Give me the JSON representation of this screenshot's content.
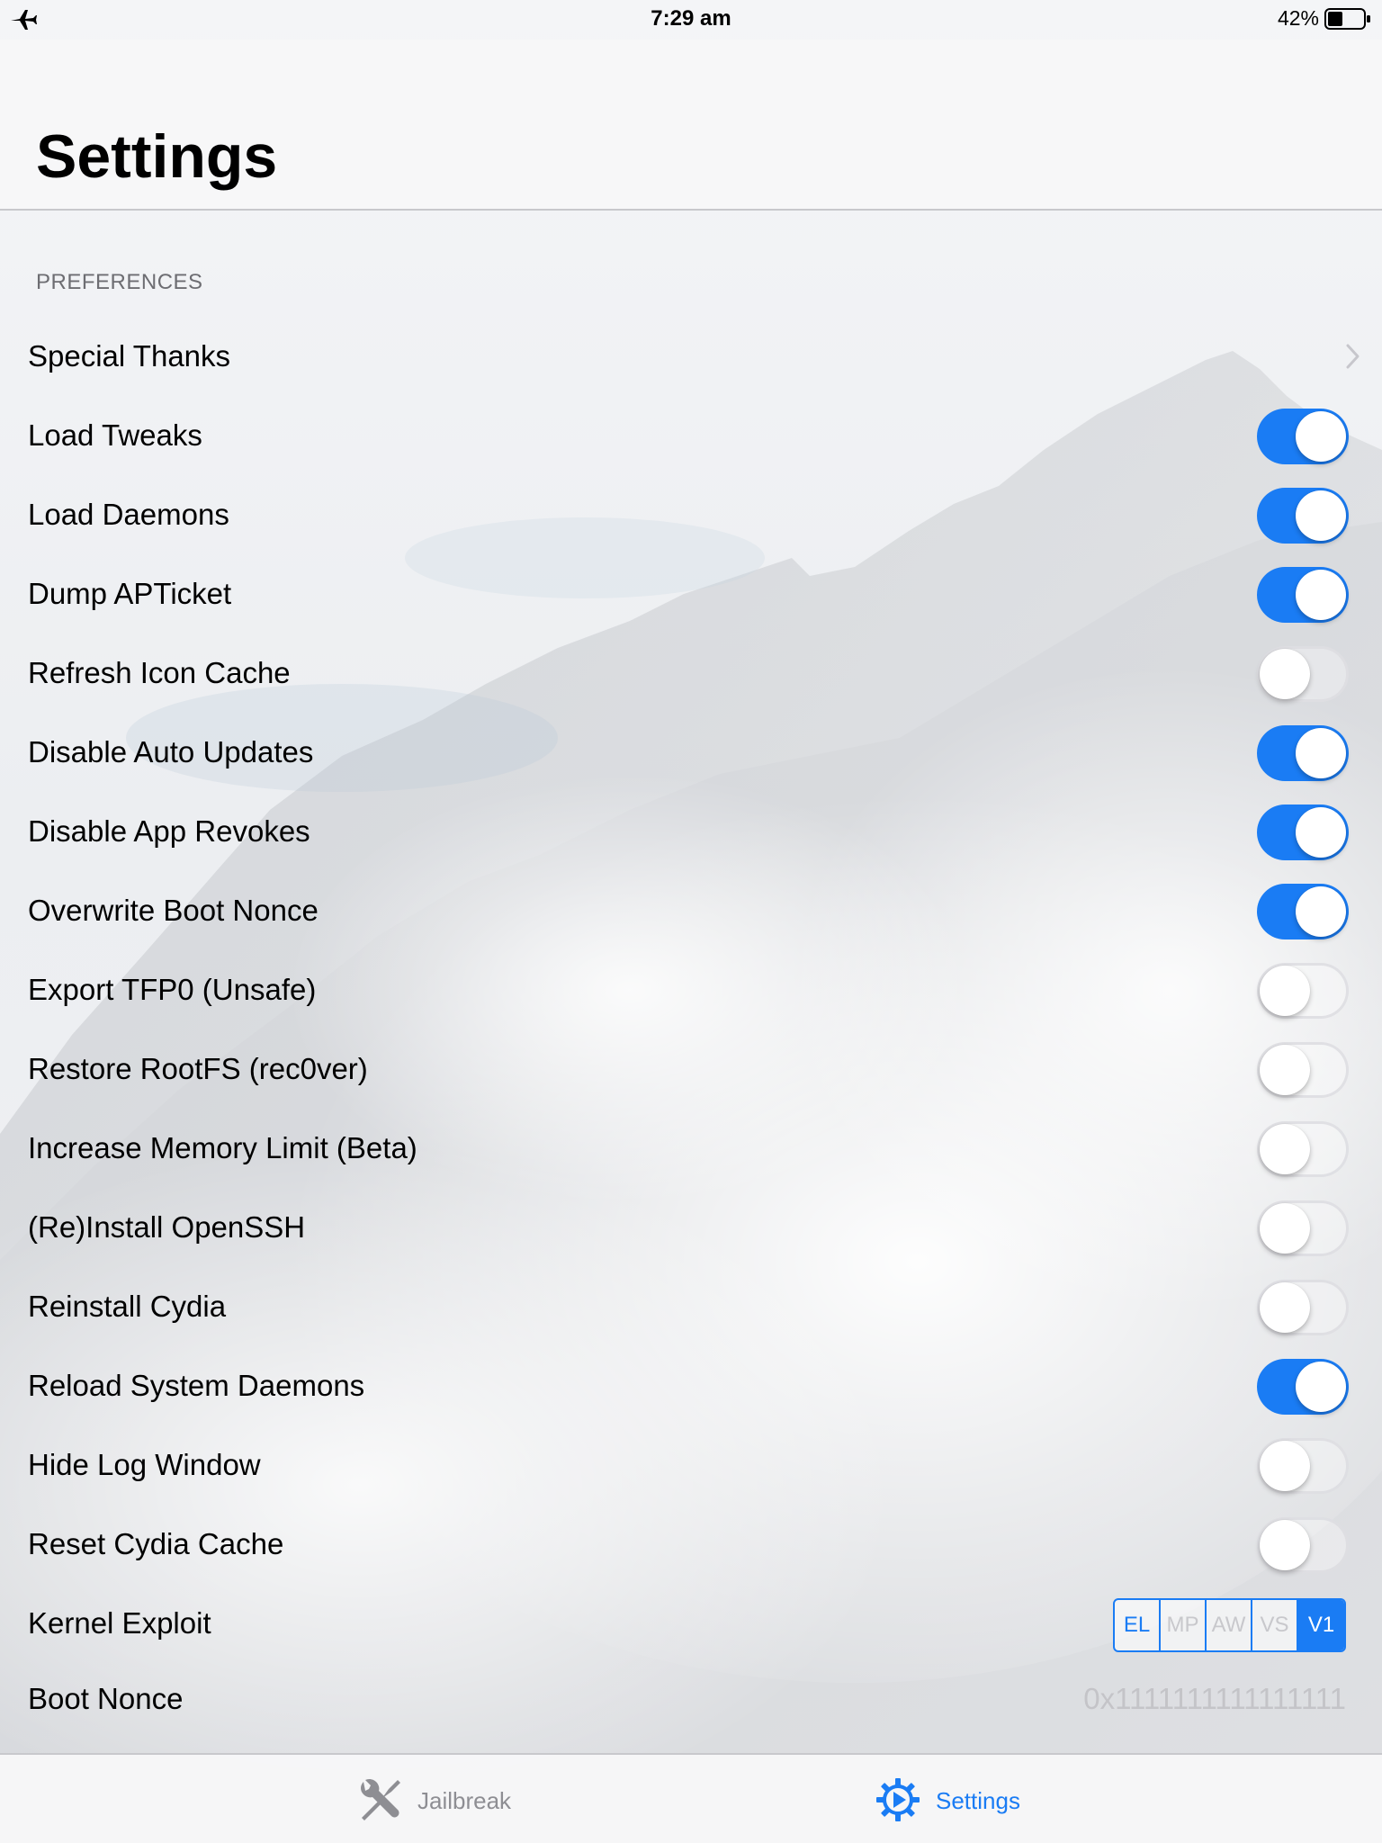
{
  "status_bar": {
    "time": "7:29 am",
    "battery_percent": "42%",
    "battery_level": 0.42,
    "airplane_mode_icon": "airplane-icon"
  },
  "header": {
    "title": "Settings"
  },
  "preferences": {
    "section_title": "PREFERENCES",
    "items": [
      {
        "label": "Special Thanks",
        "type": "link"
      },
      {
        "label": "Load Tweaks",
        "type": "toggle",
        "on": true
      },
      {
        "label": "Load Daemons",
        "type": "toggle",
        "on": true
      },
      {
        "label": "Dump APTicket",
        "type": "toggle",
        "on": true
      },
      {
        "label": "Refresh Icon Cache",
        "type": "toggle",
        "on": false
      },
      {
        "label": "Disable Auto Updates",
        "type": "toggle",
        "on": true
      },
      {
        "label": "Disable App Revokes",
        "type": "toggle",
        "on": true
      },
      {
        "label": "Overwrite Boot Nonce",
        "type": "toggle",
        "on": true
      },
      {
        "label": "Export TFP0 (Unsafe)",
        "type": "toggle",
        "on": false
      },
      {
        "label": "Restore RootFS (rec0ver)",
        "type": "toggle",
        "on": false
      },
      {
        "label": "Increase Memory Limit (Beta)",
        "type": "toggle",
        "on": false
      },
      {
        "label": "(Re)Install OpenSSH",
        "type": "toggle",
        "on": false
      },
      {
        "label": "Reinstall Cydia",
        "type": "toggle",
        "on": false
      },
      {
        "label": "Reload System Daemons",
        "type": "toggle",
        "on": true
      },
      {
        "label": "Hide Log Window",
        "type": "toggle",
        "on": false
      },
      {
        "label": "Reset Cydia Cache",
        "type": "toggle",
        "on": false
      }
    ],
    "kernel_exploit": {
      "label": "Kernel Exploit",
      "options": [
        "EL",
        "MP",
        "AW",
        "VS",
        "V1"
      ],
      "selected": "V1"
    },
    "boot_nonce": {
      "label": "Boot Nonce",
      "value": "0x1111111111111111"
    }
  },
  "tab_bar": {
    "tabs": [
      {
        "label": "Jailbreak",
        "icon": "tools-icon",
        "selected": false
      },
      {
        "label": "Settings",
        "icon": "gear-icon",
        "selected": true
      }
    ]
  },
  "colors": {
    "accent": "#1a7cf4",
    "secondary_text": "#6d6d72",
    "inactive_tab": "#8e8e93"
  }
}
